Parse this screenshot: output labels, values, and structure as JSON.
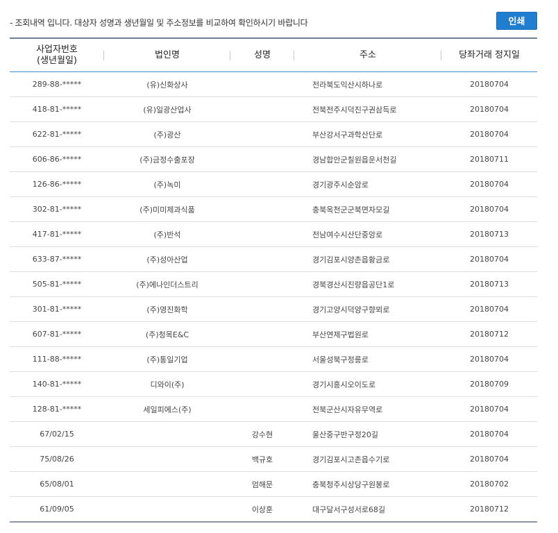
{
  "notice": "- 조회내역 입니다. 대상자 성명과 생년월일 및 주소정보를 비교하여 확인하시기 바랍니다",
  "print_label": "인쇄",
  "columns": {
    "id_line1": "사업자번호",
    "id_line2": "(생년월일)",
    "company": "법인명",
    "name": "성명",
    "address": "주소",
    "date": "당좌거래 정지일"
  },
  "rows": [
    {
      "id": "289-88-*****",
      "company": "(유)신화상사",
      "name": "",
      "address": "전라북도익산시하나로",
      "date": "20180704"
    },
    {
      "id": "418-81-*****",
      "company": "(유)일광산업사",
      "name": "",
      "address": "전북전주시덕진구권삼득로",
      "date": "20180704"
    },
    {
      "id": "622-81-*****",
      "company": "(주)광산",
      "name": "",
      "address": "부산강서구과학산단로",
      "date": "20180704"
    },
    {
      "id": "606-86-*****",
      "company": "(주)금정수출포장",
      "name": "",
      "address": "경남합안군칠원읍운서천길",
      "date": "20180711"
    },
    {
      "id": "126-86-*****",
      "company": "(주)녹미",
      "name": "",
      "address": "경기광주시순암로",
      "date": "20180704"
    },
    {
      "id": "302-81-*****",
      "company": "(주)미미제과식품",
      "name": "",
      "address": "충북옥천군군북면자모길",
      "date": "20180704"
    },
    {
      "id": "417-81-*****",
      "company": "(주)반석",
      "name": "",
      "address": "전남여수시산단중앙로",
      "date": "20180713"
    },
    {
      "id": "633-87-*****",
      "company": "(주)성아산업",
      "name": "",
      "address": "경기김포시양촌읍황금로",
      "date": "20180704"
    },
    {
      "id": "505-81-*****",
      "company": "(주)에나인더스트리",
      "name": "",
      "address": "경북경산시진량읍공단1로",
      "date": "20180713"
    },
    {
      "id": "301-81-*****",
      "company": "(주)영진화학",
      "name": "",
      "address": "경기고양시덕양구향뫼로",
      "date": "20180704"
    },
    {
      "id": "607-81-*****",
      "company": "(주)청목E&C",
      "name": "",
      "address": "부산연제구법원로",
      "date": "20180712"
    },
    {
      "id": "111-88-*****",
      "company": "(주)통일기업",
      "name": "",
      "address": "서울성북구정릉로",
      "date": "20180704"
    },
    {
      "id": "140-81-*****",
      "company": "디와이(주)",
      "name": "",
      "address": "경기시흥시오이도로",
      "date": "20180709"
    },
    {
      "id": "128-81-*****",
      "company": "세일피에스(주)",
      "name": "",
      "address": "전북군산시자유무역로",
      "date": "20180704"
    },
    {
      "id": "67/02/15",
      "company": "",
      "name": "강수현",
      "address": "울산중구반구정20길",
      "date": "20180704"
    },
    {
      "id": "75/08/26",
      "company": "",
      "name": "백규호",
      "address": "경기김포시고촌읍수기로",
      "date": "20180704"
    },
    {
      "id": "65/08/01",
      "company": "",
      "name": "엄해문",
      "address": "충북청주시상당구원봉로",
      "date": "20180702"
    },
    {
      "id": "61/09/05",
      "company": "",
      "name": "이상훈",
      "address": "대구달서구성서로68길",
      "date": "20180712"
    }
  ]
}
